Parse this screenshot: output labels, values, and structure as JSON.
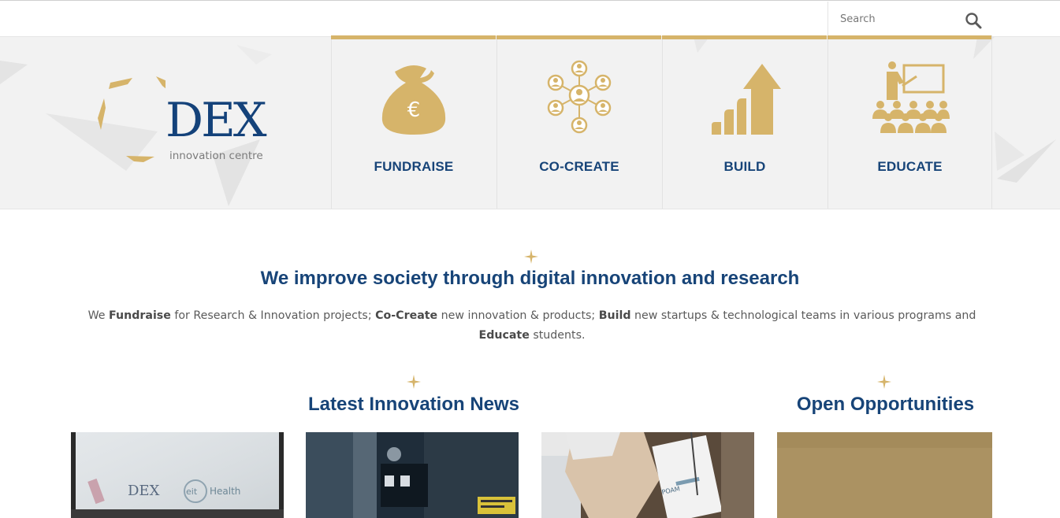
{
  "search": {
    "placeholder": "Search"
  },
  "logo": {
    "name": "DEX",
    "tagline": "innovation centre"
  },
  "tiles": [
    {
      "label": "FUNDRAISE",
      "icon": "money-bag-euro-icon"
    },
    {
      "label": "CO-CREATE",
      "icon": "network-people-icon"
    },
    {
      "label": "BUILD",
      "icon": "growth-bars-arrow-icon"
    },
    {
      "label": "EDUCATE",
      "icon": "teacher-classroom-icon"
    }
  ],
  "headline": "We improve society through digital innovation and research",
  "intro": {
    "p1": "We ",
    "b1": "Fundraise",
    "p2": " for Research & Innovation projects; ",
    "b2": "Co-Create",
    "p3": " new innovation & products; ",
    "b3": "Build",
    "p4": " new startups & technological teams in various programs and ",
    "b4": "Educate",
    "p5": " students."
  },
  "sections": {
    "news": "Latest Innovation News",
    "opportunities": "Open Opportunities"
  },
  "news_card_texts": {
    "dex_screen": "DEX",
    "eit": "eit",
    "health": "Health",
    "doc": "POAM"
  },
  "colors": {
    "accent_gold": "#d6b46a",
    "brand_blue": "#174478",
    "hero_bg": "#f2f2f2"
  }
}
